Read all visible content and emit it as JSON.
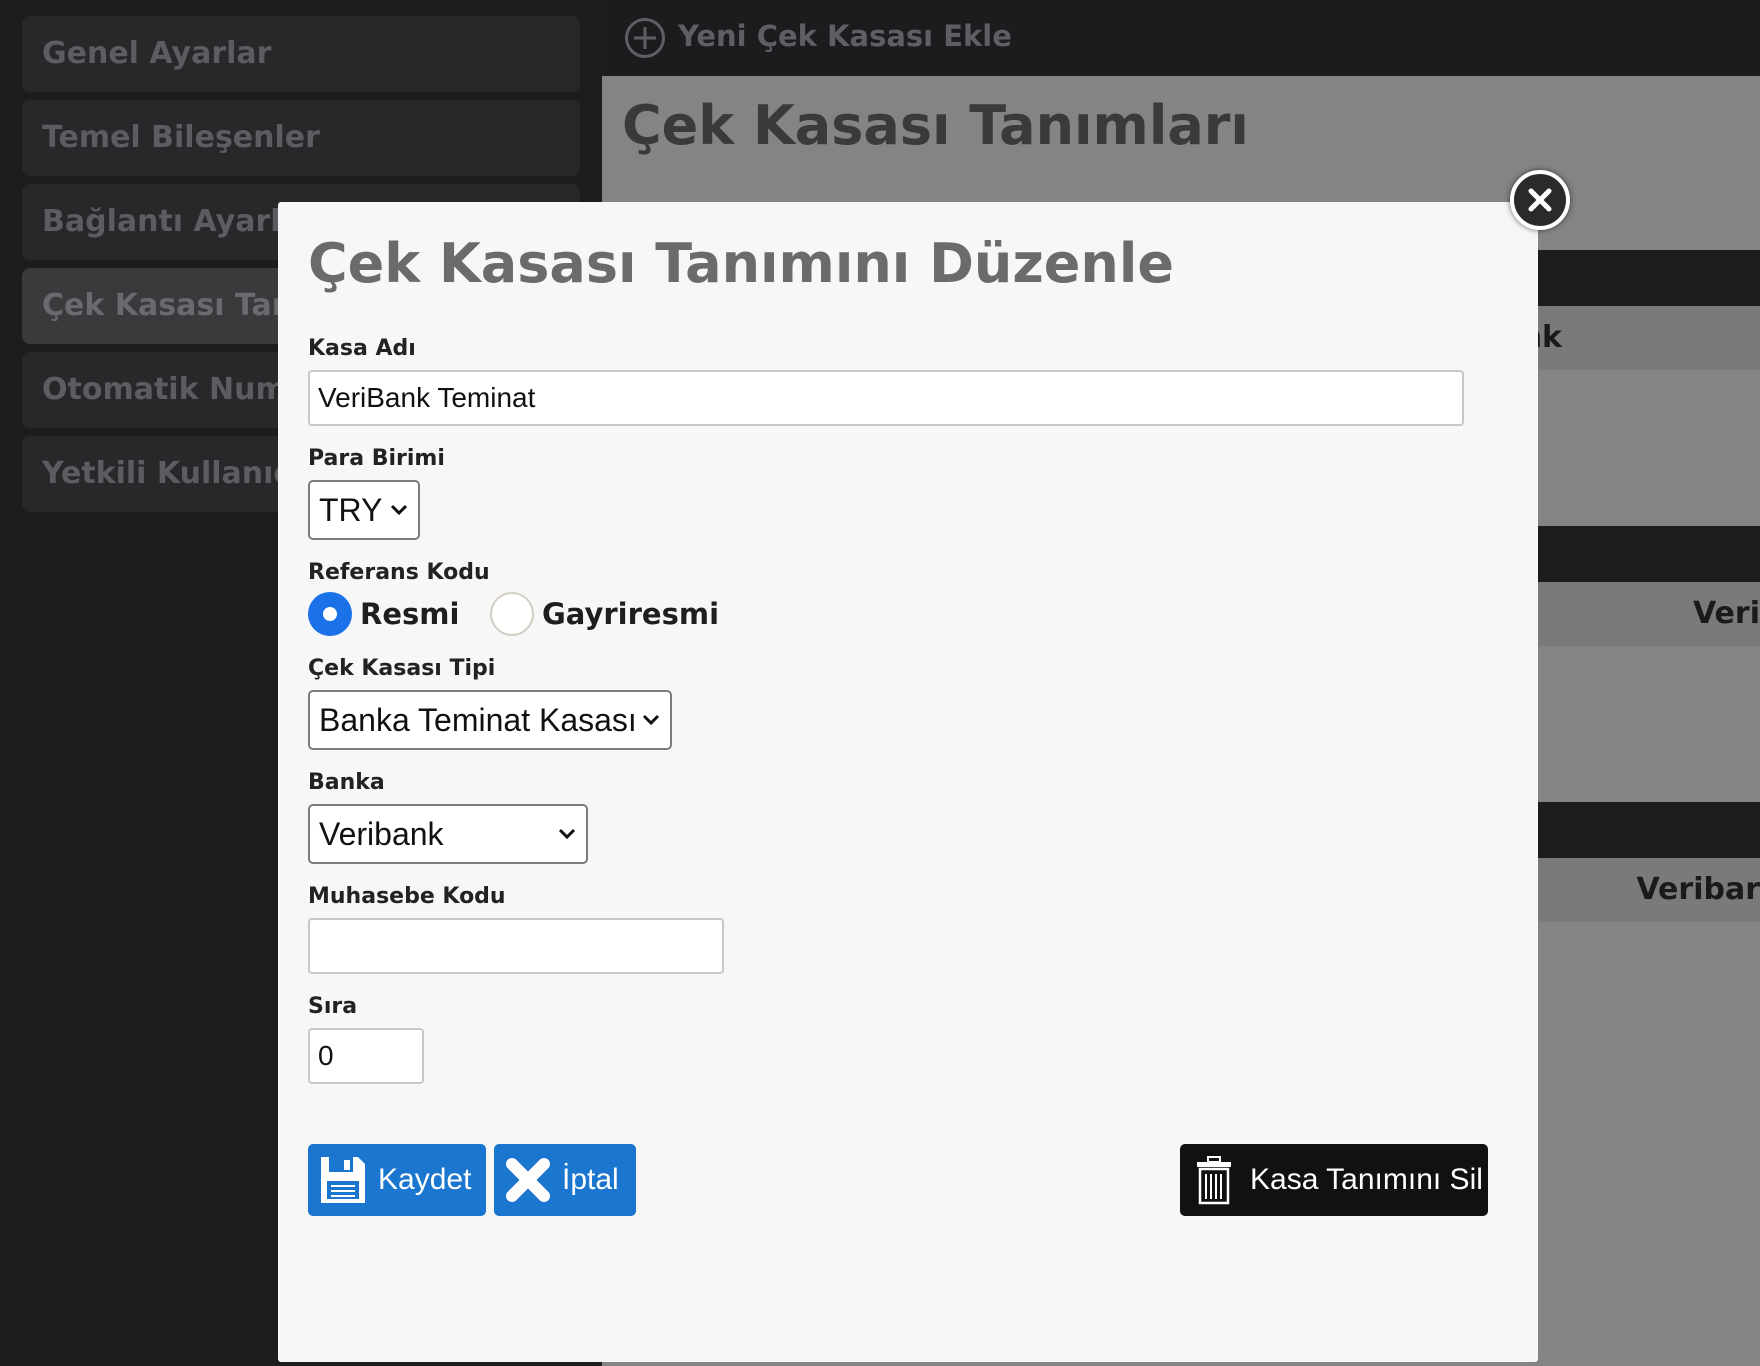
{
  "sidebar": {
    "items": [
      {
        "label": "Genel Ayarlar"
      },
      {
        "label": "Temel Bileşenler"
      },
      {
        "label": "Bağlantı Ayarları"
      },
      {
        "label": "Çek Kasası Tanımları"
      },
      {
        "label": "Otomatik Numaralar"
      },
      {
        "label": "Yetkili Kullanıcılar"
      }
    ],
    "active_index": 3
  },
  "topbar": {
    "add_label": "Yeni Çek Kasası Ekle",
    "add_icon": "plus-circle-icon"
  },
  "background": {
    "title": "Çek Kasası Tanımları",
    "row_texts": [
      "nk",
      "Veri",
      "Veribar"
    ]
  },
  "modal": {
    "title": "Çek Kasası Tanımını Düzenle",
    "close_icon": "close-icon",
    "fields": {
      "kasa_adi": {
        "label": "Kasa Adı",
        "value": "VeriBank Teminat"
      },
      "para_birimi": {
        "label": "Para Birimi",
        "value": "TRY"
      },
      "referans_kodu": {
        "label": "Referans Kodu",
        "options": [
          {
            "label": "Resmi",
            "selected": true
          },
          {
            "label": "Gayriresmi",
            "selected": false
          }
        ]
      },
      "kasa_tipi": {
        "label": "Çek Kasası Tipi",
        "value": "Banka Teminat Kasası"
      },
      "banka": {
        "label": "Banka",
        "value": "Veribank"
      },
      "muhasebe_kodu": {
        "label": "Muhasebe Kodu",
        "value": ""
      },
      "sira": {
        "label": "Sıra",
        "value": "0"
      }
    },
    "buttons": {
      "save": {
        "label": "Kaydet",
        "icon": "floppy-disk-icon"
      },
      "cancel": {
        "label": "İptal",
        "icon": "x-icon"
      },
      "delete": {
        "label": "Kasa Tanımını Sil",
        "icon": "trash-icon"
      }
    },
    "colors": {
      "primary_blue": "#1a76cf",
      "radio_blue": "#1b72e8",
      "delete_button": "#111111"
    }
  }
}
